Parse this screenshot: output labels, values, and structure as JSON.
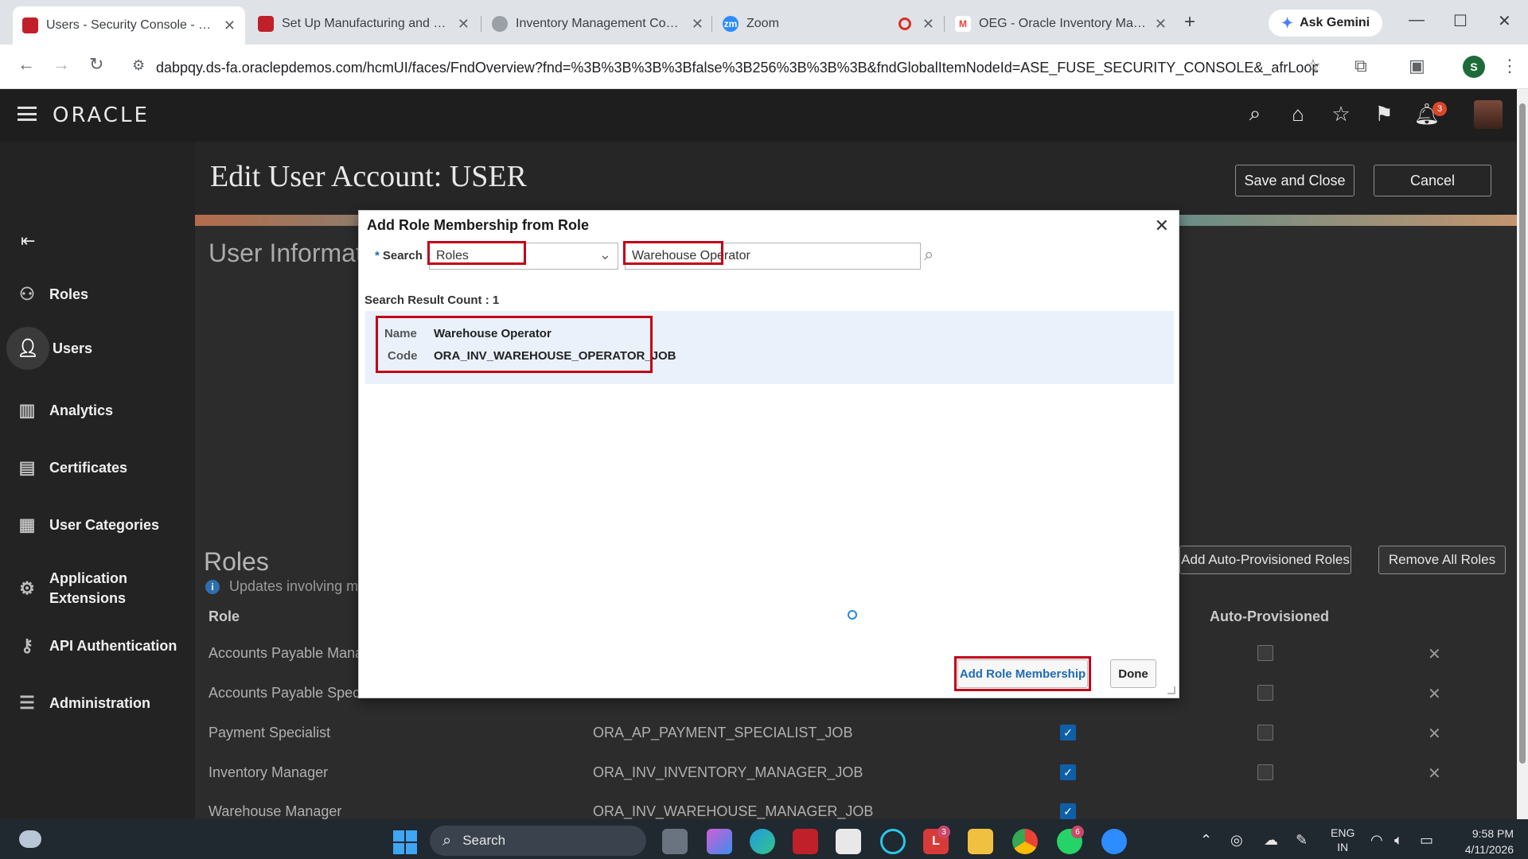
{
  "browser": {
    "tabs": [
      {
        "title": "Users - Security Console - Ora",
        "favicon_color": "#c0202a"
      },
      {
        "title": "Set Up Manufacturing and Sup",
        "favicon_color": "#c0202a"
      },
      {
        "title": "Inventory Management Config",
        "favicon_color": "#9aa0a6"
      },
      {
        "title": "Zoom",
        "favicon_color": "#2d8cff"
      },
      {
        "title": "OEG - Oracle Inventory Manag",
        "favicon_color": "#ea4335"
      }
    ],
    "zoom_favicon_text": "zm",
    "gmail_favicon_text": "M",
    "gemini_label": "Ask Gemini",
    "url": "dabpqy.ds-fa.oraclepdemos.com/hcmUI/faces/FndOverview?fnd=%3B%3B%3B%3Bfalse%3B256%3B%3B%3B&fndGlobalItemNodeId=ASE_FUSE_SECURITY_CONSOLE&_afrLoop=352...",
    "profile_initial": "S"
  },
  "app": {
    "logo": "ORACLE",
    "notification_count": "3",
    "page_title": "Edit User Account: USER",
    "save_close_label": "Save and Close",
    "cancel_label": "Cancel",
    "sidebar": [
      {
        "label": "Roles",
        "icon": "roles-icon"
      },
      {
        "label": "Users",
        "icon": "users-icon"
      },
      {
        "label": "Analytics",
        "icon": "analytics-icon"
      },
      {
        "label": "Certificates",
        "icon": "certificates-icon"
      },
      {
        "label": "User Categories",
        "icon": "user-categories-icon"
      },
      {
        "label": "Application",
        "label2": "Extensions",
        "icon": "application-extensions-icon"
      },
      {
        "label": "API Authentication",
        "icon": "api-authentication-icon"
      },
      {
        "label": "Administration",
        "icon": "administration-icon"
      }
    ],
    "user_info_heading": "User Informat",
    "roles_heading": "Roles",
    "roles_note": "Updates involving m",
    "add_auto_provisioned_label": "Add Auto-Provisioned Roles",
    "remove_all_label": "Remove All Roles",
    "col_role": "Role",
    "col_auto_provisioned": "Auto-Provisioned",
    "rows": [
      {
        "role": "Accounts Payable Mana",
        "code": "",
        "checked": false
      },
      {
        "role": "Accounts Payable Spec",
        "code": "",
        "checked": false
      },
      {
        "role": "Payment Specialist",
        "code": "ORA_AP_PAYMENT_SPECIALIST_JOB",
        "checked": true
      },
      {
        "role": "Inventory Manager",
        "code": "ORA_INV_INVENTORY_MANAGER_JOB",
        "checked": true
      },
      {
        "role": "Warehouse Manager",
        "code": "ORA_INV_WAREHOUSE_MANAGER_JOB",
        "checked": true
      }
    ]
  },
  "modal": {
    "title": "Add Role Membership from Role",
    "search_label": "Search",
    "search_type": "Roles",
    "search_value": "Warehouse Operator",
    "result_count": "Search Result Count : 1",
    "name_label": "Name",
    "name_value": "Warehouse Operator",
    "code_label": "Code",
    "code_value": "ORA_INV_WAREHOUSE_OPERATOR_JOB",
    "add_label": "Add Role Membership",
    "done_label": "Done"
  },
  "taskbar": {
    "search_label": "Search",
    "lang_line1": "ENG",
    "lang_line2": "IN",
    "time": "9:58 PM",
    "date": "4/11/2026",
    "badge_l": "3",
    "badge_whatsapp": "6"
  }
}
